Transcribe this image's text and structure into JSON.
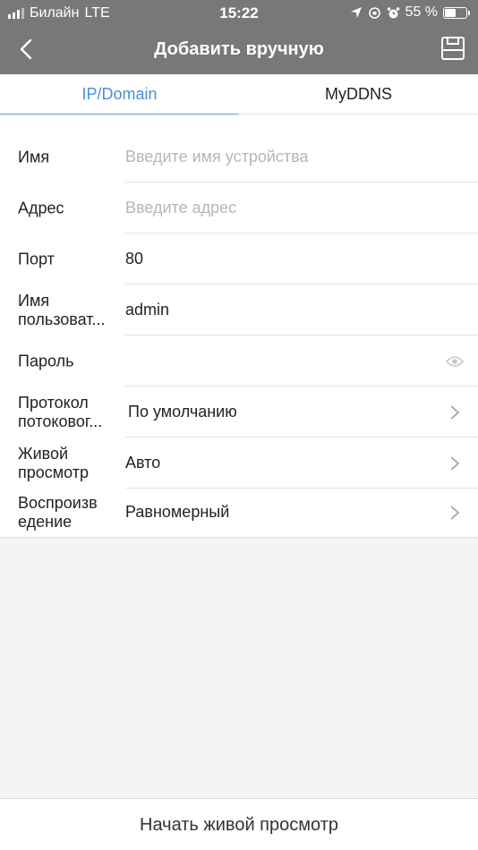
{
  "status_bar": {
    "carrier": "Билайн",
    "network": "LTE",
    "time": "15:22",
    "battery": "55 %",
    "battery_level": 0.55
  },
  "header": {
    "title": "Добавить вручную"
  },
  "tabs": [
    {
      "label": "IP/Domain",
      "active": true
    },
    {
      "label": "MyDDNS",
      "active": false
    }
  ],
  "form": {
    "name": {
      "label": "Имя",
      "placeholder": "Введите имя устройства"
    },
    "address": {
      "label": "Адрес",
      "placeholder": "Введите адрес"
    },
    "port": {
      "label": "Порт",
      "value": "80"
    },
    "username": {
      "label": "Имя пользоват...",
      "value": "admin"
    },
    "password": {
      "label": "Пароль",
      "value": ""
    },
    "stream_protocol": {
      "label": "Протокол потоковог...",
      "value": "По умолчанию"
    },
    "live_view": {
      "label": "Живой просмотр",
      "value": "Авто"
    },
    "playback": {
      "label": "Воспроизв едение",
      "value": "Равномерный"
    }
  },
  "footer": {
    "start_live_label": "Начать живой просмотр"
  },
  "colors": {
    "header_bg": "#787878",
    "accent": "#4a90d9",
    "placeholder": "#b6b6b6"
  }
}
